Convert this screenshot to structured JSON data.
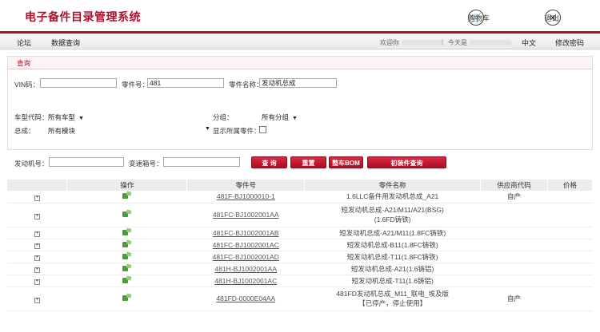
{
  "header": {
    "title": "电子备件目录管理系统",
    "cart_label": "购物车",
    "logout_label": "退出"
  },
  "nav": {
    "items": [
      "论坛",
      "数据查询"
    ],
    "welcome": "欢迎你",
    "today": "今天是",
    "lang": "中文",
    "change_password": "修改密码"
  },
  "query": {
    "panel_title": "查询",
    "vin_label": "VIN码：",
    "vin_value": "",
    "part_no_label": "零件号：",
    "part_no_value": "481",
    "part_name_label": "零件名称：",
    "part_name_value": "发动机总成",
    "model_label": "车型代码：",
    "model_value": "所有车型",
    "group_label": "分组：",
    "group_value": "所有分组",
    "assembly_label": "总成：",
    "assembly_value": "所有模块",
    "show_all_label": "显示所属零件：",
    "engine_no_label": "发动机号：",
    "engine_no_value": "",
    "gearbox_no_label": "变速箱号：",
    "gearbox_no_value": "",
    "btn_query": "查 询",
    "btn_reset": "重置",
    "btn_full_bom": "整车BOM",
    "btn_initial_query": "初装件查询"
  },
  "table": {
    "columns": [
      "操作",
      "零件号",
      "零件名称",
      "供应商代码",
      "价格"
    ],
    "rows": [
      {
        "part_no": "481F-BJ1000010-1",
        "name": "1.6LLC备件用发动机总成_A21",
        "supplier": "自产",
        "price": ""
      },
      {
        "part_no": "481FC-BJ1002001AA",
        "name": "短发动机总成-A21/M11/A21(BSG)",
        "name2": "(1.6FD铸铁)",
        "supplier": "",
        "price": ""
      },
      {
        "part_no": "481FC-BJ1002001AB",
        "name": "短发动机总成-A21/M11(1.8FC铸铁)",
        "supplier": "",
        "price": ""
      },
      {
        "part_no": "481FC-BJ1002001AC",
        "name": "短发动机总成-B11(1.8FC铸铁)",
        "supplier": "",
        "price": ""
      },
      {
        "part_no": "481FC-BJ1002001AD",
        "name": "短发动机总成-T11(1.8FC铸铁)",
        "supplier": "",
        "price": ""
      },
      {
        "part_no": "481H-BJ1002001AA",
        "name": "短发动机总成-A21(1.6铸铝)",
        "supplier": "",
        "price": ""
      },
      {
        "part_no": "481H-BJ1002001AC",
        "name": "短发动机总成-T11(1.6铸铝)",
        "supplier": "",
        "price": ""
      },
      {
        "part_no": "481FD-0000E04AA",
        "name": "481FD发动机总成_M11_联电_埃及版",
        "name2": "【已停产，停止使用】",
        "supplier": "自产",
        "price": ""
      }
    ]
  },
  "icons": {
    "expander": "plus-box-icon",
    "row_action": "parts-diagram-icon",
    "cart": "cart-icon",
    "logout": "close-circle-icon"
  },
  "colors": {
    "brand": "#b0102b",
    "button": "#c41d35",
    "header_bg": "#ececec"
  }
}
